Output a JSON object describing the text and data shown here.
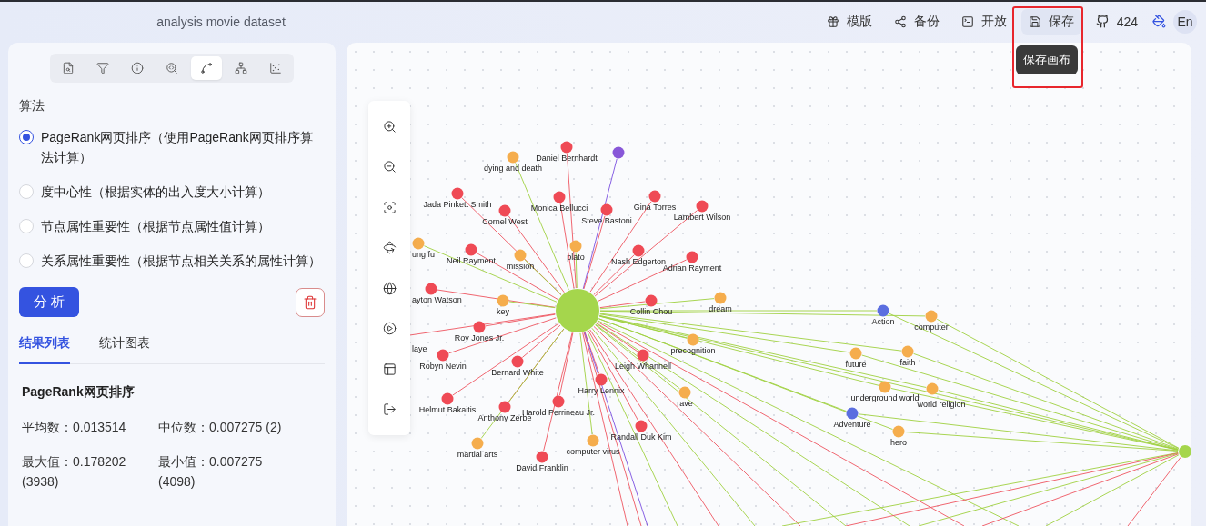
{
  "header": {
    "title": "analysis movie dataset",
    "actions": [
      {
        "label": "模版",
        "active": false
      },
      {
        "label": "备份",
        "active": false
      },
      {
        "label": "开放",
        "active": false
      },
      {
        "label": "保存",
        "active": true
      }
    ],
    "github_count": "424",
    "language": "En",
    "tooltip": "保存画布"
  },
  "panel": {
    "tool_tabs": [
      {
        "selected": false
      },
      {
        "selected": false
      },
      {
        "selected": false
      },
      {
        "selected": false
      },
      {
        "selected": true
      },
      {
        "selected": false
      },
      {
        "selected": false
      }
    ],
    "section_label": "算法",
    "algorithms": [
      {
        "label": "PageRank网页排序（使用PageRank网页排序算法计算）",
        "selected": true
      },
      {
        "label": "度中心性（根据实体的出入度大小计算）",
        "selected": false
      },
      {
        "label": "节点属性重要性（根据节点属性值计算）",
        "selected": false
      },
      {
        "label": "关系属性重要性（根据节点相关关系的属性计算）",
        "selected": false
      }
    ],
    "analyze_button": "分 析",
    "result_tabs": [
      {
        "label": "结果列表",
        "selected": true
      },
      {
        "label": "统计图表",
        "selected": false
      }
    ],
    "result_title": "PageRank网页排序",
    "stats": [
      "平均数：0.013514",
      "中位数：0.007275 (2)",
      "最大值：0.178202 (3938)",
      "最小值：0.007275 (4098)"
    ]
  },
  "canvas": {
    "nodes": [
      {
        "label": "dying and death",
        "color": "#f5ad4d"
      },
      {
        "label": "Daniel Bernhardt",
        "color": "#ef4a55"
      },
      {
        "color": "#8857d8"
      },
      {
        "label": "Jada Pinkett Smith",
        "color": "#ef4a55"
      },
      {
        "label": "Monica Bellucci",
        "color": "#ef4a55"
      },
      {
        "label": "Gina Torres",
        "color": "#ef4a55"
      },
      {
        "label": "Cornel West",
        "color": "#ef4a55"
      },
      {
        "label": "Steve Bastoni",
        "color": "#ef4a55"
      },
      {
        "label": "Lambert Wilson",
        "color": "#ef4a55"
      },
      {
        "label": "ung fu",
        "color": "#f5ad4d"
      },
      {
        "label": "Neil Rayment",
        "color": "#ef4a55"
      },
      {
        "label": "mission",
        "color": "#f5ad4d"
      },
      {
        "label": "plato",
        "color": "#f5ad4d"
      },
      {
        "label": "Nash Edgerton",
        "color": "#ef4a55"
      },
      {
        "label": "Adrian Rayment",
        "color": "#ef4a55"
      },
      {
        "label": "ayton Watson",
        "color": "#ef4a55"
      },
      {
        "label": "key",
        "color": "#f5ad4d"
      },
      {
        "label": "Collin Chou",
        "color": "#ef4a55"
      },
      {
        "label": "dream",
        "color": "#f5ad4d"
      },
      {
        "label": "Action",
        "color": "#5b6ee0"
      },
      {
        "label": "computer",
        "color": "#f5ad4d"
      },
      {
        "label": "laye"
      },
      {
        "label": "Roy Jones Jr.",
        "color": "#ef4a55"
      },
      {
        "label": "precognition",
        "color": "#f5ad4d"
      },
      {
        "label": "Robyn Nevin",
        "color": "#ef4a55"
      },
      {
        "label": "Bernard White",
        "color": "#ef4a55"
      },
      {
        "label": "Leigh Whannell",
        "color": "#ef4a55"
      },
      {
        "label": "future",
        "color": "#f5ad4d"
      },
      {
        "label": "faith",
        "color": "#f5ad4d"
      },
      {
        "label": "Harry Lennix",
        "color": "#ef4a55"
      },
      {
        "label": "rave",
        "color": "#f5ad4d"
      },
      {
        "label": "underground world",
        "color": "#f5ad4d"
      },
      {
        "label": "world religion",
        "color": "#f5ad4d"
      },
      {
        "label": "Helmut Bakaitis",
        "color": "#ef4a55"
      },
      {
        "label": "Anthony Zerbe",
        "color": "#ef4a55"
      },
      {
        "label": "Harold Perrineau Jr.",
        "color": "#ef4a55"
      },
      {
        "label": "Adventure",
        "color": "#5b6ee0"
      },
      {
        "label": "Randall Duk Kim",
        "color": "#ef4a55"
      },
      {
        "label": "hero",
        "color": "#f5ad4d"
      },
      {
        "label": "martial arts",
        "color": "#f5ad4d"
      },
      {
        "label": "computer virus",
        "color": "#f5ad4d"
      },
      {
        "label": "David Franklin",
        "color": "#ef4a55"
      }
    ]
  }
}
